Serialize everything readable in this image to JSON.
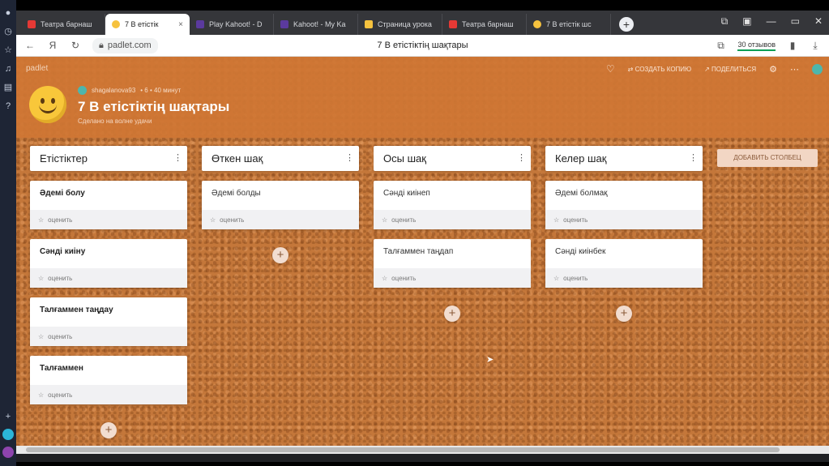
{
  "browser": {
    "tabs": [
      {
        "label": "Театра барнаш",
        "color": "#e53935",
        "active": false
      },
      {
        "label": "7 В етістік",
        "color": "#f6c23e",
        "active": true
      },
      {
        "label": "Play Kahoot! - D",
        "color": "#5b3a9e",
        "active": false
      },
      {
        "label": "Kahoot! - My Ka",
        "color": "#5b3a9e",
        "active": false
      },
      {
        "label": "Страница урока",
        "color": "#f6c23e",
        "active": false
      },
      {
        "label": "Театра барнаш",
        "color": "#e53935",
        "active": false
      },
      {
        "label": "7 В етістік шс",
        "color": "#f6c23e",
        "active": false
      }
    ],
    "active_tab_close": "×",
    "new_tab": "+",
    "win_controls": [
      "⧉",
      "▣",
      "—",
      "▭",
      "✕"
    ],
    "url": "padlet.com",
    "page_title": "7 В етістіктің шақтары",
    "reviews": "30 отзывов"
  },
  "padlet": {
    "brand": "padlet",
    "actions": {
      "remix": "⇄ создать копию",
      "share": "↗ поделиться"
    },
    "author": "shagalanova93",
    "author_meta": "• 6 •  40 минут",
    "title": "7 В етістіктің шақтары",
    "subtitle": "Сделано на волне удачи",
    "rating_label": "оценить",
    "add_column": "Добавить столбец",
    "columns": [
      {
        "title": "Етістіктер",
        "posts": [
          "Әдемі болу",
          "Сәнді киіну",
          "Талғаммен таңдау",
          "Талғаммен"
        ]
      },
      {
        "title": "Өткен шақ",
        "posts": [
          "Әдемі болды"
        ]
      },
      {
        "title": "Осы шақ",
        "posts": [
          "Сәнді киінеп",
          "Талғаммен таңдап"
        ]
      },
      {
        "title": "Келер шақ",
        "posts": [
          "Әдемі болмақ",
          "Сәнді киінбек"
        ]
      }
    ]
  }
}
